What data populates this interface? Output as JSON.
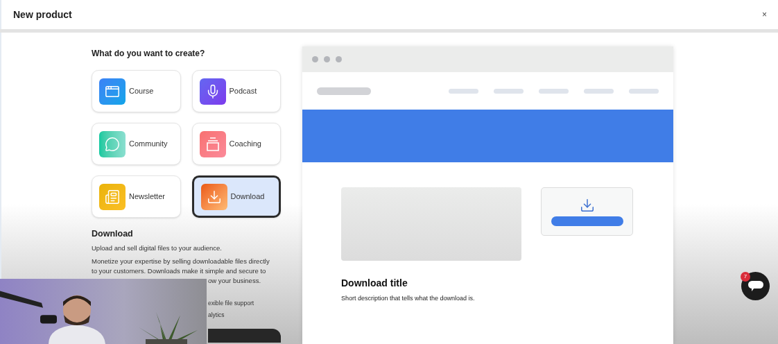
{
  "window": {
    "title": "New product",
    "close": "×"
  },
  "heading": "What do you want to create?",
  "options": [
    {
      "label": "Course",
      "kind": "course",
      "selected": false
    },
    {
      "label": "Podcast",
      "kind": "podcast",
      "selected": false
    },
    {
      "label": "Community",
      "kind": "community",
      "selected": false
    },
    {
      "label": "Coaching",
      "kind": "coaching",
      "selected": false
    },
    {
      "label": "Newsletter",
      "kind": "newsletter",
      "selected": false
    },
    {
      "label": "Download",
      "kind": "download",
      "selected": true
    }
  ],
  "detail": {
    "title": "Download",
    "subtitle": "Upload and sell digital files to your audience.",
    "lines": [
      {
        "text": "Monetize your expertise by selling downloadable files directly",
        "kind": "full"
      },
      {
        "text": "to your customers. Downloads make it simple and secure to",
        "kind": "full"
      },
      {
        "text": "ow your business.",
        "kind": "fragment"
      }
    ],
    "features": [
      "exible file support",
      "alytics"
    ]
  },
  "preview": {
    "title": "Download title",
    "description": "Short description that tells what the download is."
  },
  "chat": {
    "badge": "7"
  }
}
